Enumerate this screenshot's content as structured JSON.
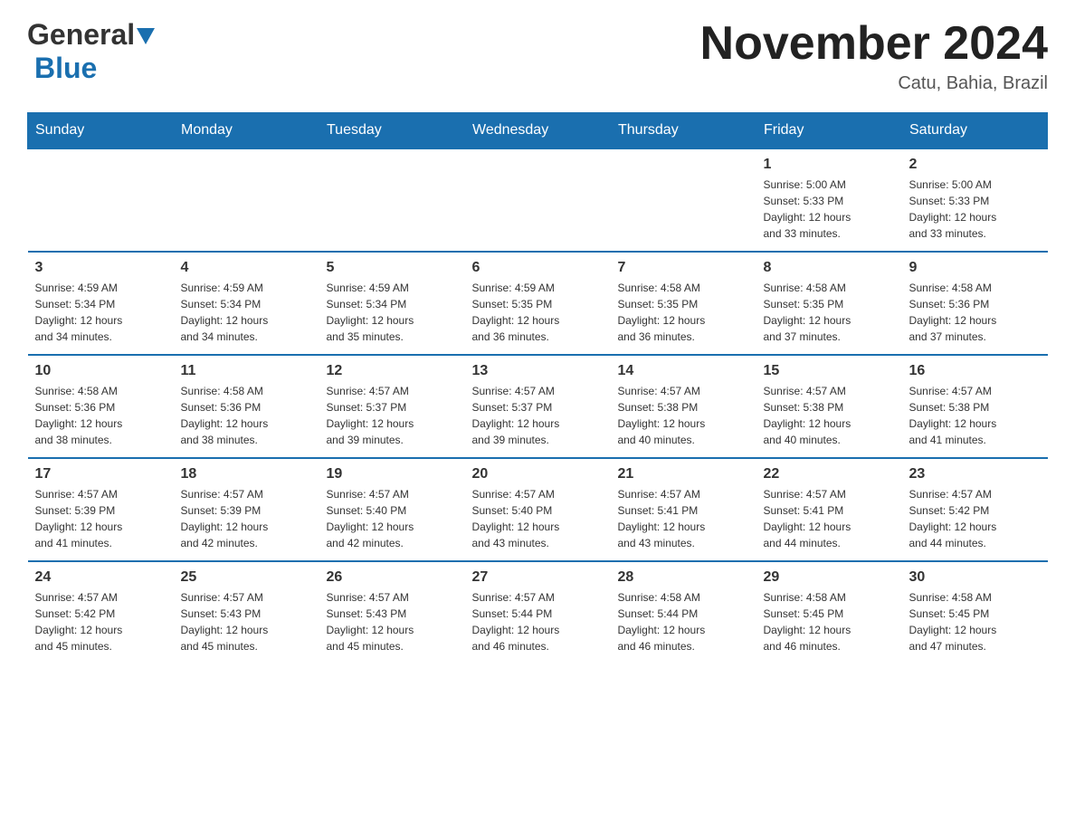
{
  "header": {
    "logo_general": "General",
    "logo_blue": "Blue",
    "month_title": "November 2024",
    "location": "Catu, Bahia, Brazil"
  },
  "days_of_week": [
    "Sunday",
    "Monday",
    "Tuesday",
    "Wednesday",
    "Thursday",
    "Friday",
    "Saturday"
  ],
  "weeks": [
    [
      {
        "day": "",
        "info": ""
      },
      {
        "day": "",
        "info": ""
      },
      {
        "day": "",
        "info": ""
      },
      {
        "day": "",
        "info": ""
      },
      {
        "day": "",
        "info": ""
      },
      {
        "day": "1",
        "info": "Sunrise: 5:00 AM\nSunset: 5:33 PM\nDaylight: 12 hours\nand 33 minutes."
      },
      {
        "day": "2",
        "info": "Sunrise: 5:00 AM\nSunset: 5:33 PM\nDaylight: 12 hours\nand 33 minutes."
      }
    ],
    [
      {
        "day": "3",
        "info": "Sunrise: 4:59 AM\nSunset: 5:34 PM\nDaylight: 12 hours\nand 34 minutes."
      },
      {
        "day": "4",
        "info": "Sunrise: 4:59 AM\nSunset: 5:34 PM\nDaylight: 12 hours\nand 34 minutes."
      },
      {
        "day": "5",
        "info": "Sunrise: 4:59 AM\nSunset: 5:34 PM\nDaylight: 12 hours\nand 35 minutes."
      },
      {
        "day": "6",
        "info": "Sunrise: 4:59 AM\nSunset: 5:35 PM\nDaylight: 12 hours\nand 36 minutes."
      },
      {
        "day": "7",
        "info": "Sunrise: 4:58 AM\nSunset: 5:35 PM\nDaylight: 12 hours\nand 36 minutes."
      },
      {
        "day": "8",
        "info": "Sunrise: 4:58 AM\nSunset: 5:35 PM\nDaylight: 12 hours\nand 37 minutes."
      },
      {
        "day": "9",
        "info": "Sunrise: 4:58 AM\nSunset: 5:36 PM\nDaylight: 12 hours\nand 37 minutes."
      }
    ],
    [
      {
        "day": "10",
        "info": "Sunrise: 4:58 AM\nSunset: 5:36 PM\nDaylight: 12 hours\nand 38 minutes."
      },
      {
        "day": "11",
        "info": "Sunrise: 4:58 AM\nSunset: 5:36 PM\nDaylight: 12 hours\nand 38 minutes."
      },
      {
        "day": "12",
        "info": "Sunrise: 4:57 AM\nSunset: 5:37 PM\nDaylight: 12 hours\nand 39 minutes."
      },
      {
        "day": "13",
        "info": "Sunrise: 4:57 AM\nSunset: 5:37 PM\nDaylight: 12 hours\nand 39 minutes."
      },
      {
        "day": "14",
        "info": "Sunrise: 4:57 AM\nSunset: 5:38 PM\nDaylight: 12 hours\nand 40 minutes."
      },
      {
        "day": "15",
        "info": "Sunrise: 4:57 AM\nSunset: 5:38 PM\nDaylight: 12 hours\nand 40 minutes."
      },
      {
        "day": "16",
        "info": "Sunrise: 4:57 AM\nSunset: 5:38 PM\nDaylight: 12 hours\nand 41 minutes."
      }
    ],
    [
      {
        "day": "17",
        "info": "Sunrise: 4:57 AM\nSunset: 5:39 PM\nDaylight: 12 hours\nand 41 minutes."
      },
      {
        "day": "18",
        "info": "Sunrise: 4:57 AM\nSunset: 5:39 PM\nDaylight: 12 hours\nand 42 minutes."
      },
      {
        "day": "19",
        "info": "Sunrise: 4:57 AM\nSunset: 5:40 PM\nDaylight: 12 hours\nand 42 minutes."
      },
      {
        "day": "20",
        "info": "Sunrise: 4:57 AM\nSunset: 5:40 PM\nDaylight: 12 hours\nand 43 minutes."
      },
      {
        "day": "21",
        "info": "Sunrise: 4:57 AM\nSunset: 5:41 PM\nDaylight: 12 hours\nand 43 minutes."
      },
      {
        "day": "22",
        "info": "Sunrise: 4:57 AM\nSunset: 5:41 PM\nDaylight: 12 hours\nand 44 minutes."
      },
      {
        "day": "23",
        "info": "Sunrise: 4:57 AM\nSunset: 5:42 PM\nDaylight: 12 hours\nand 44 minutes."
      }
    ],
    [
      {
        "day": "24",
        "info": "Sunrise: 4:57 AM\nSunset: 5:42 PM\nDaylight: 12 hours\nand 45 minutes."
      },
      {
        "day": "25",
        "info": "Sunrise: 4:57 AM\nSunset: 5:43 PM\nDaylight: 12 hours\nand 45 minutes."
      },
      {
        "day": "26",
        "info": "Sunrise: 4:57 AM\nSunset: 5:43 PM\nDaylight: 12 hours\nand 45 minutes."
      },
      {
        "day": "27",
        "info": "Sunrise: 4:57 AM\nSunset: 5:44 PM\nDaylight: 12 hours\nand 46 minutes."
      },
      {
        "day": "28",
        "info": "Sunrise: 4:58 AM\nSunset: 5:44 PM\nDaylight: 12 hours\nand 46 minutes."
      },
      {
        "day": "29",
        "info": "Sunrise: 4:58 AM\nSunset: 5:45 PM\nDaylight: 12 hours\nand 46 minutes."
      },
      {
        "day": "30",
        "info": "Sunrise: 4:58 AM\nSunset: 5:45 PM\nDaylight: 12 hours\nand 47 minutes."
      }
    ]
  ]
}
